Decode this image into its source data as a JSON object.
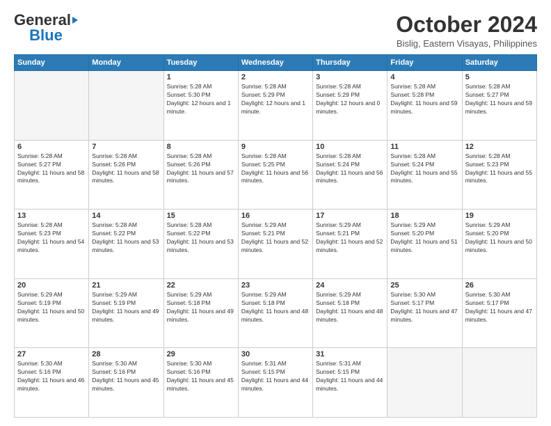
{
  "header": {
    "logo_line1": "General",
    "logo_line2": "Blue",
    "month": "October 2024",
    "location": "Bislig, Eastern Visayas, Philippines"
  },
  "days_of_week": [
    "Sunday",
    "Monday",
    "Tuesday",
    "Wednesday",
    "Thursday",
    "Friday",
    "Saturday"
  ],
  "weeks": [
    [
      {
        "day": "",
        "empty": true
      },
      {
        "day": "",
        "empty": true
      },
      {
        "day": "1",
        "sunrise": "5:28 AM",
        "sunset": "5:30 PM",
        "daylight": "12 hours and 1 minute."
      },
      {
        "day": "2",
        "sunrise": "5:28 AM",
        "sunset": "5:29 PM",
        "daylight": "12 hours and 1 minute."
      },
      {
        "day": "3",
        "sunrise": "5:28 AM",
        "sunset": "5:29 PM",
        "daylight": "12 hours and 0 minutes."
      },
      {
        "day": "4",
        "sunrise": "5:28 AM",
        "sunset": "5:28 PM",
        "daylight": "11 hours and 59 minutes."
      },
      {
        "day": "5",
        "sunrise": "5:28 AM",
        "sunset": "5:27 PM",
        "daylight": "11 hours and 59 minutes."
      }
    ],
    [
      {
        "day": "6",
        "sunrise": "5:28 AM",
        "sunset": "5:27 PM",
        "daylight": "11 hours and 58 minutes."
      },
      {
        "day": "7",
        "sunrise": "5:28 AM",
        "sunset": "5:26 PM",
        "daylight": "11 hours and 58 minutes."
      },
      {
        "day": "8",
        "sunrise": "5:28 AM",
        "sunset": "5:26 PM",
        "daylight": "11 hours and 57 minutes."
      },
      {
        "day": "9",
        "sunrise": "5:28 AM",
        "sunset": "5:25 PM",
        "daylight": "11 hours and 56 minutes."
      },
      {
        "day": "10",
        "sunrise": "5:28 AM",
        "sunset": "5:24 PM",
        "daylight": "11 hours and 56 minutes."
      },
      {
        "day": "11",
        "sunrise": "5:28 AM",
        "sunset": "5:24 PM",
        "daylight": "11 hours and 55 minutes."
      },
      {
        "day": "12",
        "sunrise": "5:28 AM",
        "sunset": "5:23 PM",
        "daylight": "11 hours and 55 minutes."
      }
    ],
    [
      {
        "day": "13",
        "sunrise": "5:28 AM",
        "sunset": "5:23 PM",
        "daylight": "11 hours and 54 minutes."
      },
      {
        "day": "14",
        "sunrise": "5:28 AM",
        "sunset": "5:22 PM",
        "daylight": "11 hours and 53 minutes."
      },
      {
        "day": "15",
        "sunrise": "5:28 AM",
        "sunset": "5:22 PM",
        "daylight": "11 hours and 53 minutes."
      },
      {
        "day": "16",
        "sunrise": "5:29 AM",
        "sunset": "5:21 PM",
        "daylight": "11 hours and 52 minutes."
      },
      {
        "day": "17",
        "sunrise": "5:29 AM",
        "sunset": "5:21 PM",
        "daylight": "11 hours and 52 minutes."
      },
      {
        "day": "18",
        "sunrise": "5:29 AM",
        "sunset": "5:20 PM",
        "daylight": "11 hours and 51 minutes."
      },
      {
        "day": "19",
        "sunrise": "5:29 AM",
        "sunset": "5:20 PM",
        "daylight": "11 hours and 50 minutes."
      }
    ],
    [
      {
        "day": "20",
        "sunrise": "5:29 AM",
        "sunset": "5:19 PM",
        "daylight": "11 hours and 50 minutes."
      },
      {
        "day": "21",
        "sunrise": "5:29 AM",
        "sunset": "5:19 PM",
        "daylight": "11 hours and 49 minutes."
      },
      {
        "day": "22",
        "sunrise": "5:29 AM",
        "sunset": "5:18 PM",
        "daylight": "11 hours and 49 minutes."
      },
      {
        "day": "23",
        "sunrise": "5:29 AM",
        "sunset": "5:18 PM",
        "daylight": "11 hours and 48 minutes."
      },
      {
        "day": "24",
        "sunrise": "5:29 AM",
        "sunset": "5:18 PM",
        "daylight": "11 hours and 48 minutes."
      },
      {
        "day": "25",
        "sunrise": "5:30 AM",
        "sunset": "5:17 PM",
        "daylight": "11 hours and 47 minutes."
      },
      {
        "day": "26",
        "sunrise": "5:30 AM",
        "sunset": "5:17 PM",
        "daylight": "11 hours and 47 minutes."
      }
    ],
    [
      {
        "day": "27",
        "sunrise": "5:30 AM",
        "sunset": "5:16 PM",
        "daylight": "11 hours and 46 minutes."
      },
      {
        "day": "28",
        "sunrise": "5:30 AM",
        "sunset": "5:16 PM",
        "daylight": "11 hours and 45 minutes."
      },
      {
        "day": "29",
        "sunrise": "5:30 AM",
        "sunset": "5:16 PM",
        "daylight": "11 hours and 45 minutes."
      },
      {
        "day": "30",
        "sunrise": "5:31 AM",
        "sunset": "5:15 PM",
        "daylight": "11 hours and 44 minutes."
      },
      {
        "day": "31",
        "sunrise": "5:31 AM",
        "sunset": "5:15 PM",
        "daylight": "11 hours and 44 minutes."
      },
      {
        "day": "",
        "empty": true
      },
      {
        "day": "",
        "empty": true
      }
    ]
  ],
  "labels": {
    "sunrise": "Sunrise:",
    "sunset": "Sunset:",
    "daylight": "Daylight:"
  }
}
